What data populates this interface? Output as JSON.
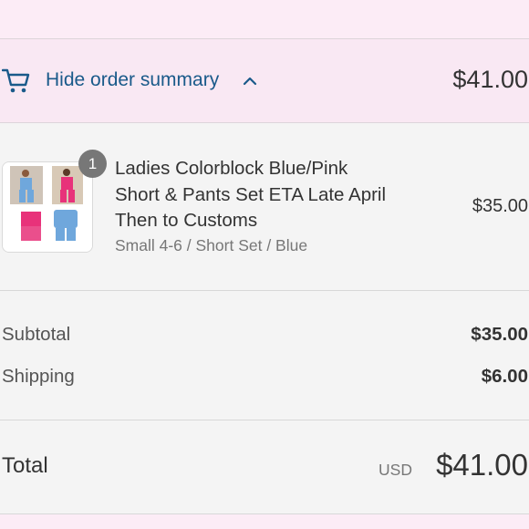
{
  "summary_toggle": {
    "label": "Hide order summary",
    "total": "$41.00",
    "icon": "cart-icon",
    "chevron": "chevron-up-icon",
    "label_color": "#1a5a8a"
  },
  "line_items": [
    {
      "quantity": "1",
      "title_lines": [
        "Ladies Colorblock Blue/Pink",
        "Short & Pants Set ETA Late April",
        "Then to Customs"
      ],
      "variant": "Small 4-6 / Short Set / Blue",
      "price": "$35.00"
    }
  ],
  "totals": {
    "subtotal_label": "Subtotal",
    "subtotal_value": "$35.00",
    "shipping_label": "Shipping",
    "shipping_value": "$6.00",
    "total_label": "Total",
    "currency": "USD",
    "total_value": "$41.00"
  },
  "colors": {
    "page_bg": "#fcecf6",
    "panel_bg": "#f4f4f4",
    "badge": "#777777",
    "product_pink": "#e8327a",
    "product_blue": "#6fa7dc"
  }
}
